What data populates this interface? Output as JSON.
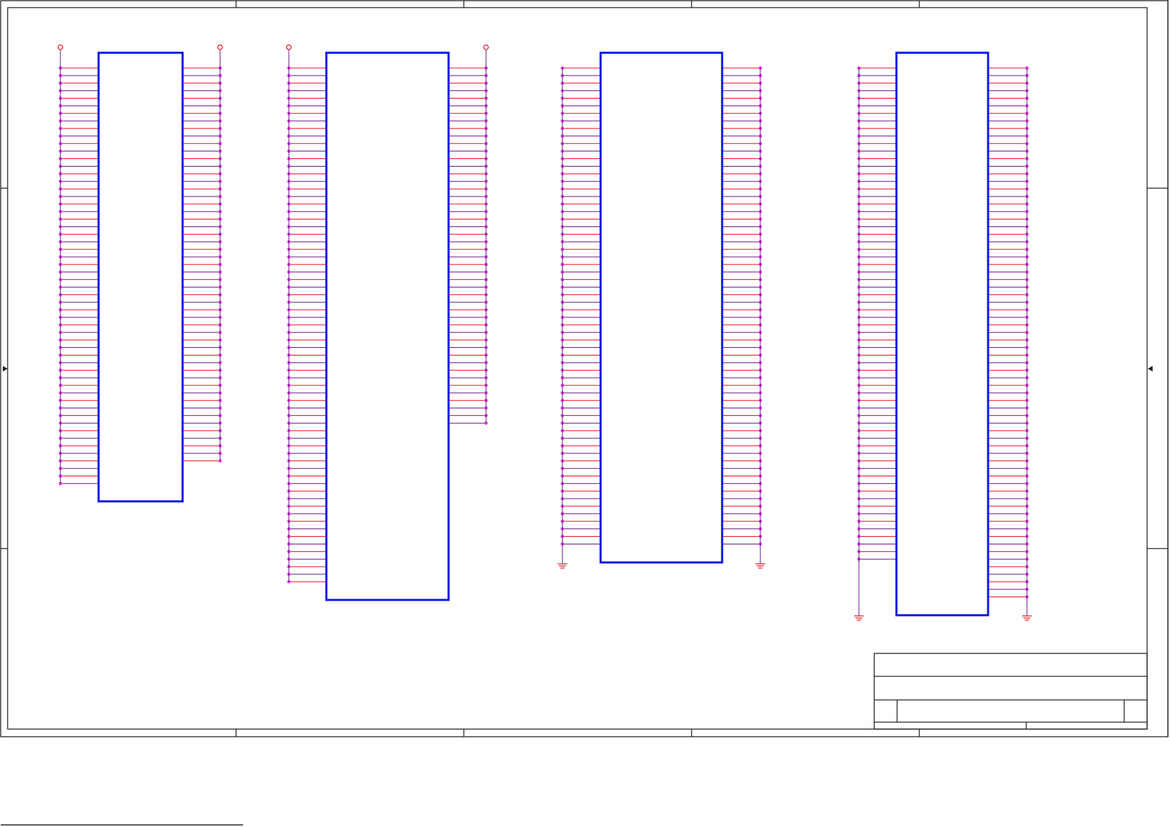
{
  "diagram": {
    "type": "schematic-sheet",
    "footer_text": "",
    "colors": {
      "component_outline": "#0a14e6",
      "wire": "#e60a14",
      "wire_alt": "#66137e",
      "junction": "#e633e6",
      "border": "#222222",
      "title_block": "#222222"
    },
    "symbols": {
      "power_port": "open-circle",
      "ground_port": "ground-icon"
    },
    "components": [
      {
        "id": "U1",
        "left_pins": 56,
        "right_pins": 53,
        "top_ports": "power",
        "bottom_ports": "none"
      },
      {
        "id": "U2",
        "left_pins": 69,
        "right_pins": 48,
        "top_ports": "power",
        "bottom_ports": "none"
      },
      {
        "id": "U3",
        "left_pins": 64,
        "right_pins": 64,
        "top_ports": "none",
        "bottom_ports": "ground"
      },
      {
        "id": "U4",
        "left_pins": 66,
        "right_pins": 71,
        "top_ports": "none",
        "bottom_ports": "ground"
      }
    ]
  }
}
